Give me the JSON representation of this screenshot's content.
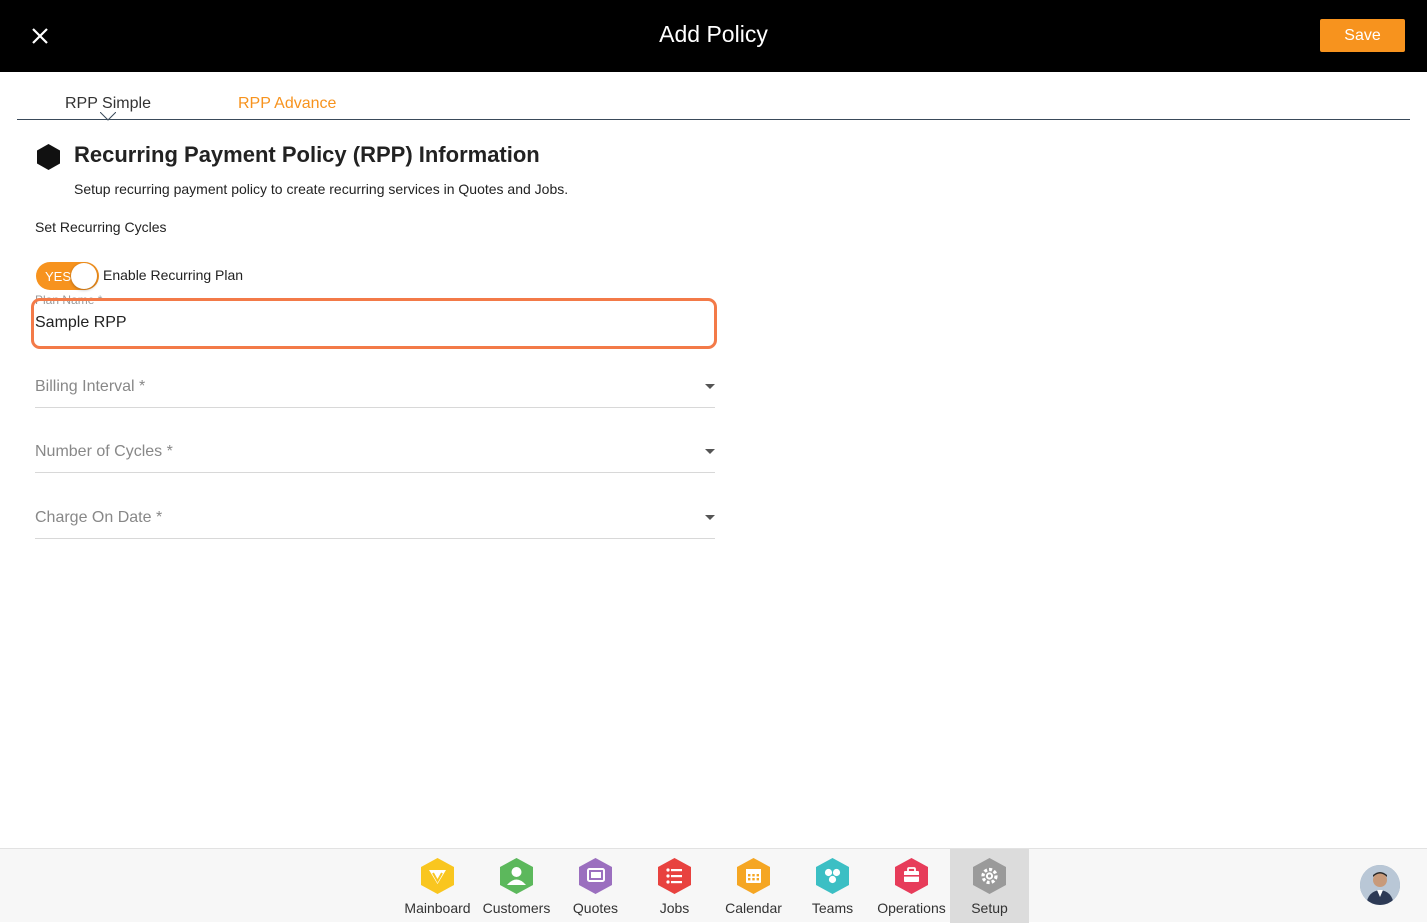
{
  "header": {
    "title": "Add Policy",
    "save_label": "Save",
    "close_icon": "close-icon"
  },
  "tabs": [
    {
      "label": "RPP Simple",
      "active": true
    },
    {
      "label": "RPP Advance",
      "active": false
    }
  ],
  "section": {
    "title": "Recurring Payment Policy (RPP) Information",
    "subtitle": "Setup recurring payment policy to create recurring services in Quotes and Jobs.",
    "icon": "hexagon-icon"
  },
  "form": {
    "cycles_label": "Set Recurring Cycles",
    "toggle": {
      "text": "YES",
      "label": "Enable Recurring Plan",
      "on": true
    },
    "plan_name": {
      "label": "Plan Name *",
      "value": "Sample RPP"
    },
    "billing_interval": {
      "placeholder": "Billing Interval *"
    },
    "number_of_cycles": {
      "placeholder": "Number of Cycles *"
    },
    "charge_on_date": {
      "placeholder": "Charge On Date *"
    }
  },
  "colors": {
    "accent": "#f7931e",
    "highlight_border": "#f37a48",
    "header_bg": "#000000"
  },
  "bottom_nav": [
    {
      "label": "Mainboard",
      "icon": "mainboard-icon",
      "color": "#f9c61f",
      "active": false
    },
    {
      "label": "Customers",
      "icon": "customers-icon",
      "color": "#5cb85c",
      "active": false
    },
    {
      "label": "Quotes",
      "icon": "quotes-icon",
      "color": "#9b6fbf",
      "active": false
    },
    {
      "label": "Jobs",
      "icon": "jobs-icon",
      "color": "#e8423f",
      "active": false
    },
    {
      "label": "Calendar",
      "icon": "calendar-icon",
      "color": "#f5a623",
      "active": false
    },
    {
      "label": "Teams",
      "icon": "teams-icon",
      "color": "#3cbfc4",
      "active": false
    },
    {
      "label": "Operations",
      "icon": "operations-icon",
      "color": "#e73c5a",
      "active": false
    },
    {
      "label": "Setup",
      "icon": "setup-icon",
      "color": "#9a9a9a",
      "active": true
    }
  ]
}
